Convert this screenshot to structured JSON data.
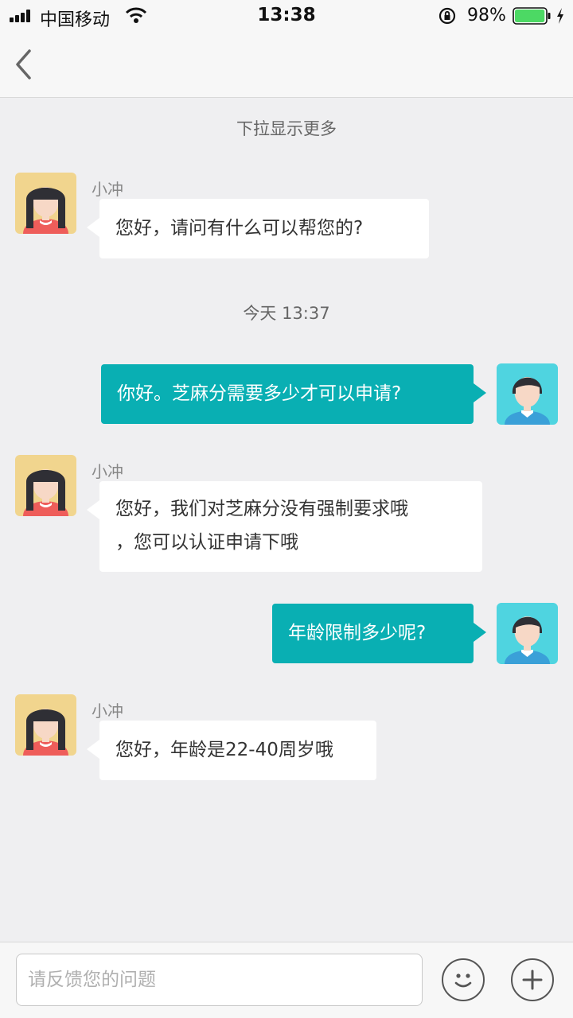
{
  "status_bar": {
    "carrier": "中国移动",
    "time": "13:38",
    "battery_percent": "98%",
    "battery_level": 0.98,
    "battery_color": "#4cd964"
  },
  "nav": {
    "back_icon": "chevron-left-icon"
  },
  "chat": {
    "pull_hint": "下拉显示更多",
    "time_separator": "今天 13:37",
    "messages": [
      {
        "direction": "in",
        "sender": "小冲",
        "text": "您好，请问有什么可以帮您的?"
      },
      {
        "direction": "out",
        "text": "你好。芝麻分需要多少才可以申请?"
      },
      {
        "direction": "in",
        "sender": "小冲",
        "lines": [
          "您好，我们对芝麻分没有强制要求哦",
          "，您可以认证申请下哦"
        ]
      },
      {
        "direction": "out",
        "text": "年龄限制多少呢?"
      },
      {
        "direction": "in",
        "sender": "小冲",
        "text": "您好，年龄是22-40周岁哦"
      }
    ]
  },
  "input_bar": {
    "placeholder": "请反馈您的问题",
    "emoji_icon": "smiley-icon",
    "plus_icon": "plus-icon"
  },
  "colors": {
    "outgoing_bubble": "#09afb3",
    "incoming_bubble": "#ffffff",
    "background": "#efeff1"
  }
}
